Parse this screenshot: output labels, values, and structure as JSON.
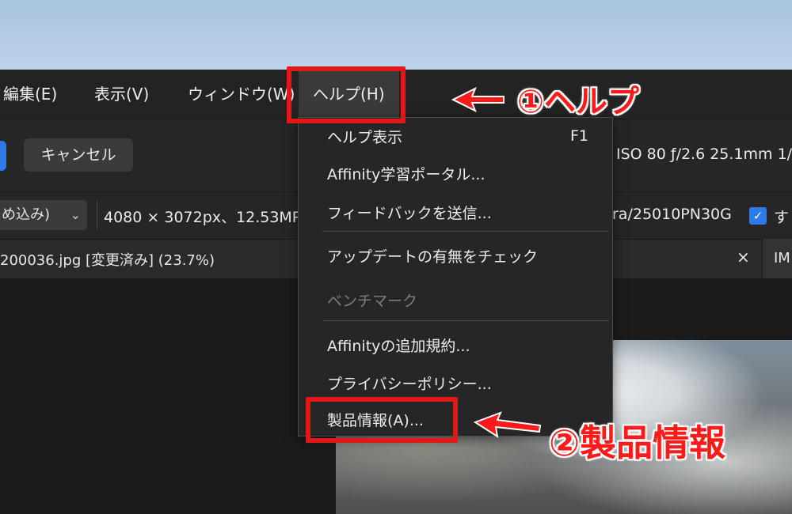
{
  "menubar": {
    "items": [
      {
        "label": "編集(E)"
      },
      {
        "label": "表示(V)"
      },
      {
        "label": "ウィンドウ(W)"
      },
      {
        "label": "ヘルプ(H)"
      }
    ]
  },
  "toolbar": {
    "cancel_label": "キャンセル",
    "exif": "ISO 80 ƒ/2.6 25.1mm 1/"
  },
  "infobar": {
    "select_value": "め込み)",
    "dimensions": "4080 × 3072px、12.53MP",
    "camera": "ra/25010PN30G",
    "checkbox_label": "す"
  },
  "tabbar": {
    "doc_title": "200036.jpg [変更済み] (23.7%)",
    "close_glyph": "×",
    "next_tab": "IM"
  },
  "help_menu": {
    "items": [
      {
        "label": "ヘルプ表示",
        "shortcut": "F1",
        "enabled": true
      },
      {
        "label": "Affinity学習ポータル...",
        "enabled": true
      },
      {
        "label": "フィードバックを送信...",
        "enabled": true
      },
      {
        "label": "アップデートの有無をチェック",
        "enabled": true
      },
      {
        "label": "ベンチマーク",
        "enabled": false
      },
      {
        "label": "Affinityの追加規約...",
        "enabled": true
      },
      {
        "label": "プライバシーポリシー...",
        "enabled": true
      },
      {
        "label": "製品情報(A)...",
        "enabled": true
      }
    ]
  },
  "annotations": {
    "step1": "①ヘルプ",
    "step2": "②製品情報",
    "highlight_color": "#e01818"
  },
  "colors": {
    "accent_blue": "#2d7be8",
    "menu_bg": "#262626",
    "app_bg": "#1c1c1c"
  }
}
